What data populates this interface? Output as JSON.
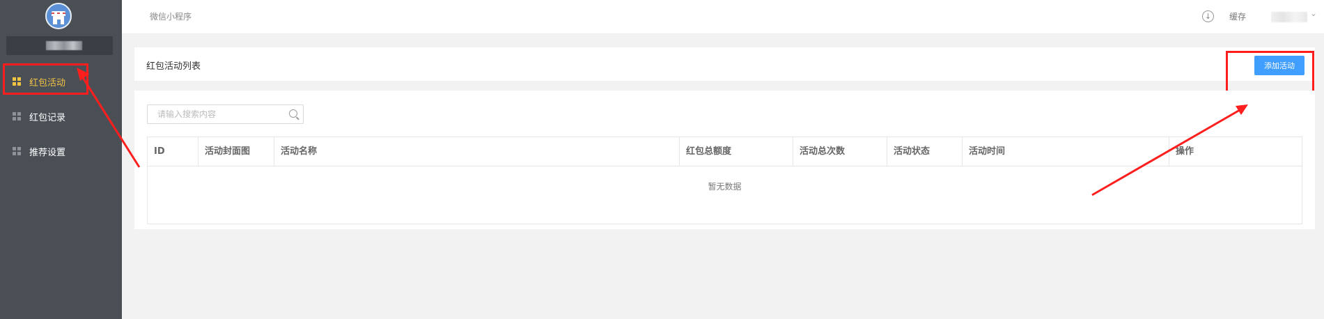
{
  "header": {
    "title": "微信小程序",
    "cache_label": "缓存",
    "download_icon": "download-icon",
    "chevron_icon": "chevron-down-icon"
  },
  "sidebar": {
    "items": [
      {
        "label": "红包活动",
        "icon": "grid-icon",
        "active": true
      },
      {
        "label": "红包记录",
        "icon": "grid-icon",
        "active": false
      },
      {
        "label": "推荐设置",
        "icon": "grid-icon",
        "active": false
      }
    ]
  },
  "main": {
    "page_title": "红包活动列表",
    "add_button": "添加活动",
    "search_placeholder": "请输入搜索内容",
    "table": {
      "columns": [
        "ID",
        "活动封面图",
        "活动名称",
        "红包总额度",
        "活动总次数",
        "活动状态",
        "活动时间",
        "操作"
      ],
      "empty_text": "暂无数据"
    }
  },
  "colors": {
    "sidebar_bg": "#4a4f56",
    "active": "#f3c443",
    "primary": "#409eff",
    "annotation": "#ff1e1e"
  }
}
